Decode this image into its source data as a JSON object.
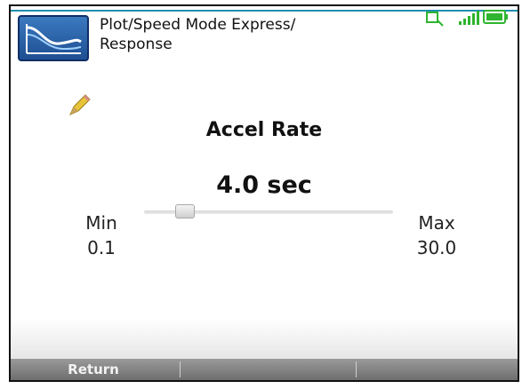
{
  "header": {
    "title_line1": "Plot/Speed Mode Express/",
    "title_line2": "Response",
    "app_icon": "plot-speed-icon",
    "status_icons": [
      "link-icon",
      "signal-strength-icon",
      "battery-icon"
    ]
  },
  "editor": {
    "edit_icon": "pencil-icon",
    "parameter_name": "Accel Rate",
    "parameter_value": "4.0 sec",
    "slider_level_fraction": 0.134,
    "min_label": "Min",
    "min_value": "0.1",
    "max_label": "Max",
    "max_value": "30.0"
  },
  "softkeys": {
    "key1": "Return",
    "key2": "",
    "key3": ""
  },
  "colors": {
    "accent_line": "#1f8fb0",
    "status_green": "#2fb52f",
    "icon_blue": "#2d67b0"
  }
}
